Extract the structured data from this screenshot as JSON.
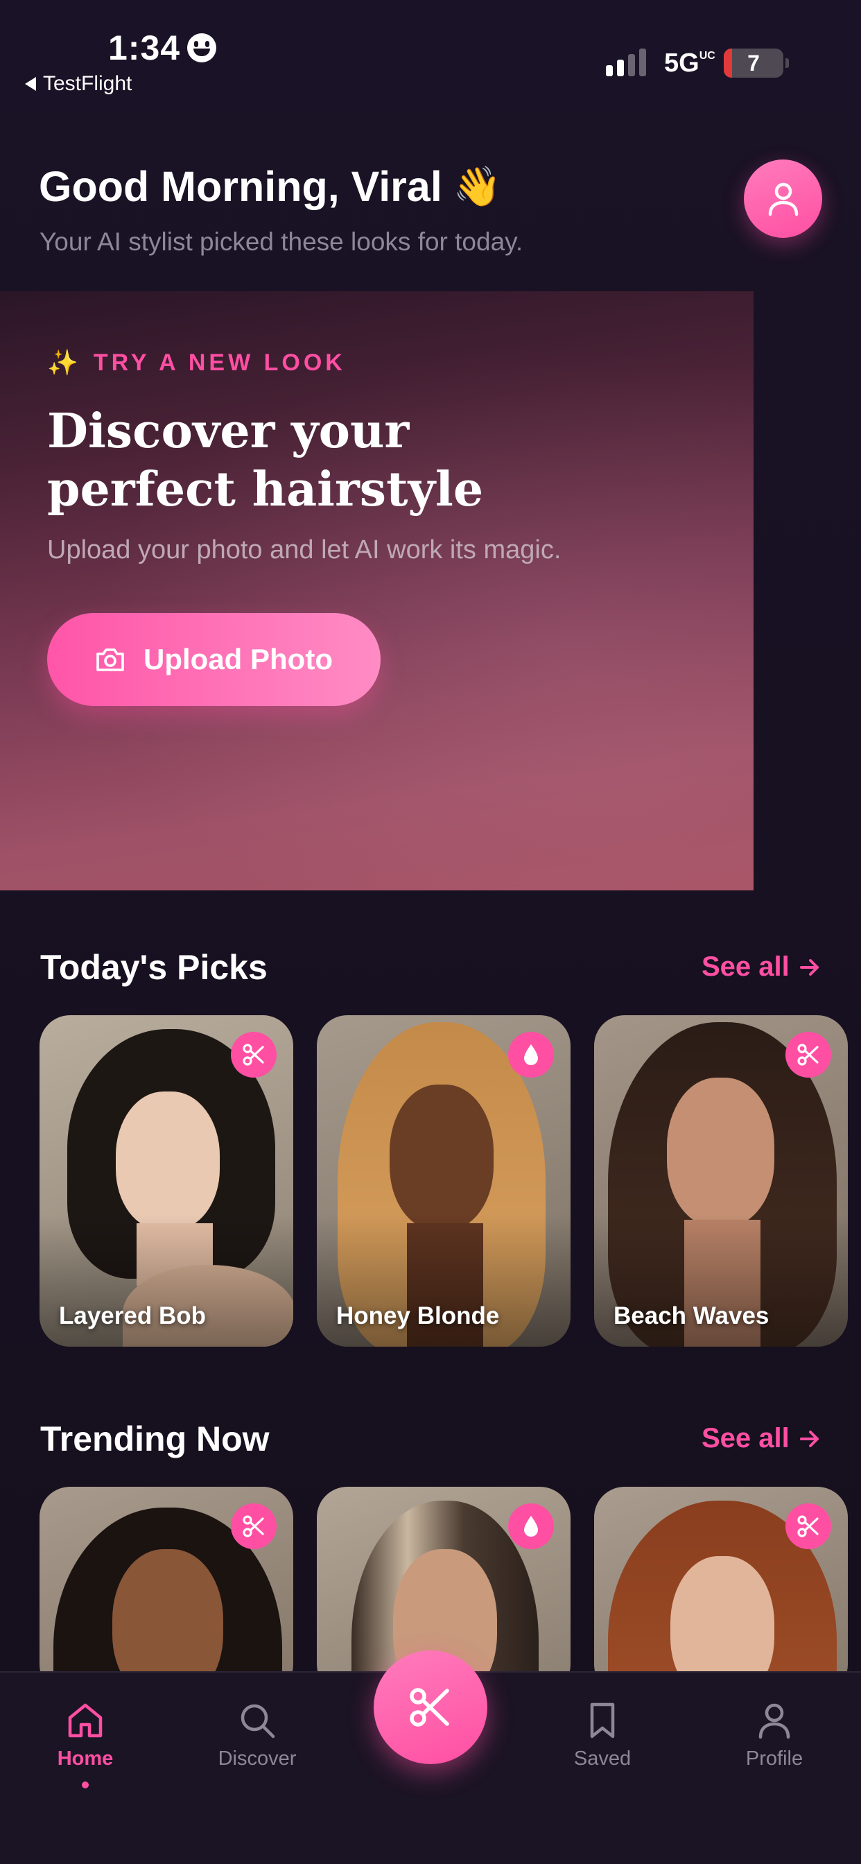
{
  "status_bar": {
    "time": "1:34",
    "back_app": "TestFlight",
    "network": "5G",
    "network_suffix": "UC",
    "battery": "7"
  },
  "header": {
    "greeting": "Good Morning, Viral",
    "greeting_emoji": "👋",
    "subtitle": "Your AI stylist picked these looks for today."
  },
  "hero": {
    "kicker_icon": "✨",
    "kicker": "TRY A NEW LOOK",
    "title": "Discover your perfect hairstyle",
    "description": "Upload your photo and let AI work its magic.",
    "button": "Upload Photo"
  },
  "todays_picks": {
    "title": "Today's Picks",
    "see_all": "See all",
    "items": [
      {
        "label": "Layered Bob",
        "badge_icon": "scissors-icon"
      },
      {
        "label": "Honey Blonde",
        "badge_icon": "drop-icon"
      },
      {
        "label": "Beach Waves",
        "badge_icon": "scissors-icon"
      }
    ]
  },
  "trending": {
    "title": "Trending Now",
    "see_all": "See all",
    "items": [
      {
        "badge_icon": "scissors-icon"
      },
      {
        "badge_icon": "drop-icon"
      },
      {
        "badge_icon": "scissors-icon"
      }
    ]
  },
  "tabbar": {
    "tabs": [
      {
        "label": "Home",
        "icon": "home-icon",
        "active": true
      },
      {
        "label": "Discover",
        "icon": "search-icon",
        "active": false
      },
      {
        "label": "Saved",
        "icon": "bookmark-icon",
        "active": false
      },
      {
        "label": "Profile",
        "icon": "user-icon",
        "active": false
      }
    ],
    "center_icon": "scissors-icon"
  },
  "colors": {
    "accent": "#ff4fa3",
    "background": "#181122",
    "muted_text": "#8d8797"
  }
}
